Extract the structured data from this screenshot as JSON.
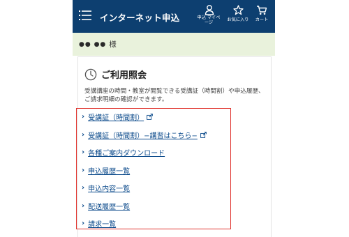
{
  "header": {
    "brand": "インターネット申込",
    "mypage_label": "申込 マイページ",
    "favorite_label": "お気に入り",
    "cart_label": "カート"
  },
  "greeting": {
    "masked_name": "●● ●●",
    "honorific": "様"
  },
  "section": {
    "title": "ご利用照会",
    "description": "受講講座の時間・教室が閲覧できる受講証（時間割）や申込履歴、ご請求明細の確認ができます。"
  },
  "links": [
    {
      "label": "受講証（時間割）",
      "external": true
    },
    {
      "label": "受講証（時間割）−講習はこちら−",
      "external": true
    },
    {
      "label": "各種ご案内ダウンロード",
      "external": false
    },
    {
      "label": "申込履歴一覧",
      "external": false
    },
    {
      "label": "申込内容一覧",
      "external": false
    },
    {
      "label": "配送履歴一覧",
      "external": false
    },
    {
      "label": "請求一覧",
      "external": false
    }
  ],
  "colors": {
    "header_bg": "#0d3f70",
    "greeting_bg": "#e9f2dc",
    "link": "#0b4a8b",
    "highlight": "#e0342e"
  }
}
